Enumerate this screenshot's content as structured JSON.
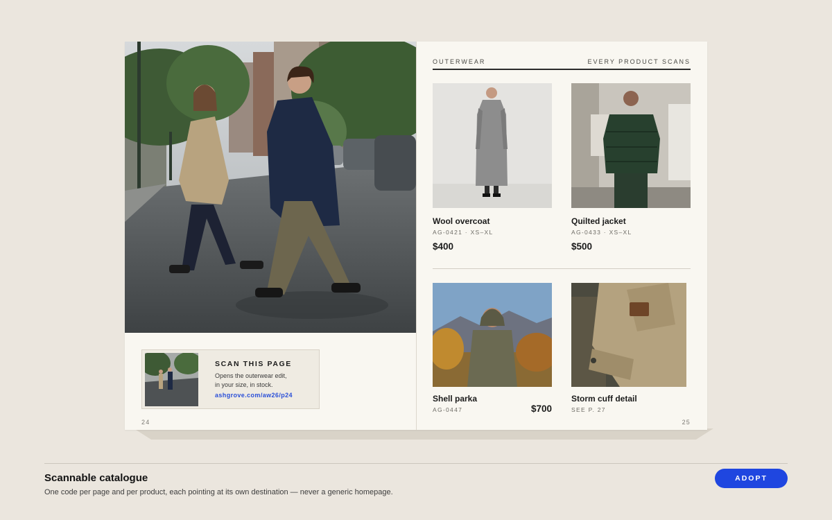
{
  "catalogue": {
    "left_page": {
      "hero": {
        "alt": "Two people in coats crossing a wet city street"
      },
      "scan_card": {
        "title": "SCAN THIS PAGE",
        "desc_line1": "Opens the outerwear edit,",
        "desc_line2": "in your size, in stock.",
        "url": "ashgrove.com/aw26/p24"
      },
      "page_number": "24"
    },
    "right_page": {
      "section_label": "OUTERWEAR",
      "section_tag": "EVERY PRODUCT SCANS",
      "products": [
        {
          "name": "Wool overcoat",
          "sku": "AG-0421 · XS–XL",
          "price": "$400"
        },
        {
          "name": "Quilted jacket",
          "sku": "AG-0433 · XS–XL",
          "price": "$500"
        },
        {
          "name": "Shell parka",
          "sku": "AG-0447",
          "price": "$700"
        },
        {
          "name": "Storm cuff detail",
          "sku": "SEE P. 27",
          "price": ""
        }
      ],
      "page_number": "25"
    }
  },
  "footer": {
    "title": "Scannable catalogue",
    "description": "One code per page and per product, each pointing at its own destination — never a generic homepage.",
    "button_label": "ADOPT"
  },
  "colors": {
    "background": "#ebe6de",
    "paper": "#f9f7f1",
    "accent": "#1f46e0",
    "link": "#2a4fd8"
  }
}
